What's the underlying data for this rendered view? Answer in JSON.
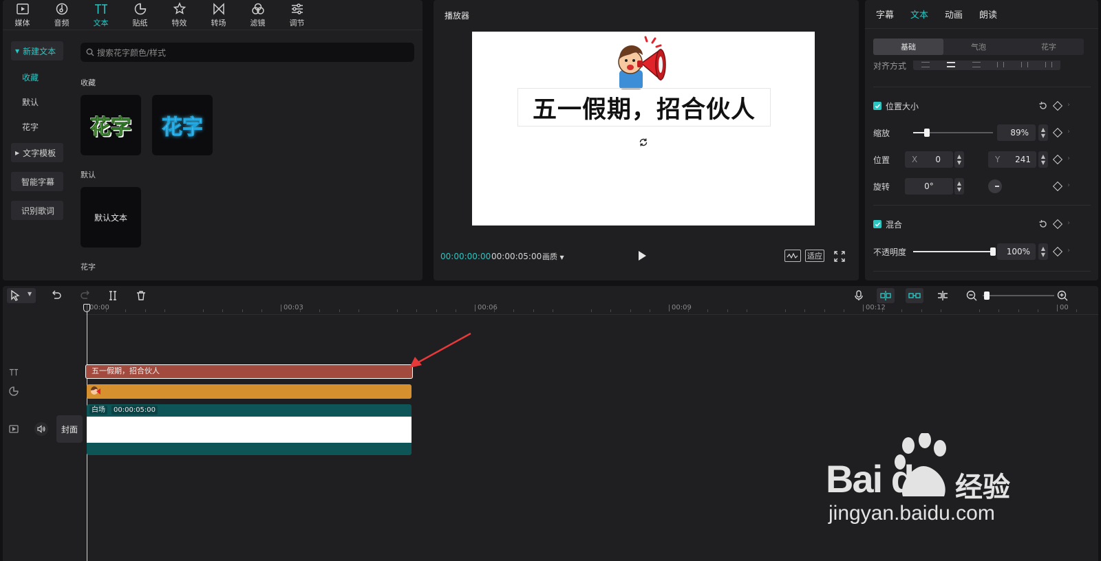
{
  "library": {
    "toolbar": [
      {
        "label": "媒体",
        "icon": "media-icon"
      },
      {
        "label": "音频",
        "icon": "audio-icon"
      },
      {
        "label": "文本",
        "icon": "text-icon"
      },
      {
        "label": "贴纸",
        "icon": "sticker-icon"
      },
      {
        "label": "特效",
        "icon": "effects-icon"
      },
      {
        "label": "转场",
        "icon": "transition-icon"
      },
      {
        "label": "滤镜",
        "icon": "filter-icon"
      },
      {
        "label": "调节",
        "icon": "adjust-icon"
      }
    ],
    "active_tool": "文本",
    "sidebar": {
      "new_text": "新建文本",
      "favorites": "收藏",
      "default": "默认",
      "fancy": "花字",
      "text_template": "文字模板",
      "smart_caption": "智能字幕",
      "lyrics": "识别歌词"
    },
    "search_placeholder": "搜索花字颜色/样式",
    "sections": {
      "favorites": "收藏",
      "default": "默认",
      "fancy": "花字"
    },
    "tiles": {
      "fancy1": "花字",
      "fancy2": "花字",
      "default_text": "默认文本"
    }
  },
  "player": {
    "title": "播放器",
    "canvas_text": "五一假期，招合伙人",
    "current_time": "00:00:00:00",
    "total_time": "00:00:05:00",
    "quality": "画质",
    "fit_button": "适应"
  },
  "properties": {
    "tabs": [
      "字幕",
      "文本",
      "动画",
      "朗读"
    ],
    "active_tab": "文本",
    "subtabs": [
      "基础",
      "气泡",
      "花字"
    ],
    "active_subtab": "基础",
    "align_label": "对齐方式",
    "position_size": {
      "title": "位置大小",
      "scale_label": "缩放",
      "scale_value": "89%",
      "scale_fraction": 0.2,
      "position_label": "位置",
      "x_label": "X",
      "x_value": "0",
      "y_label": "Y",
      "y_value": "241",
      "rotation_label": "旋转",
      "rotation_value": "0°"
    },
    "blend": {
      "title": "混合",
      "opacity_label": "不透明度",
      "opacity_value": "100%",
      "opacity_fraction": 1.0
    }
  },
  "timeline": {
    "ruler_labels": [
      "00:00",
      "00:03",
      "00:06",
      "00:09",
      "00:12",
      "00"
    ],
    "text_clip": "五一假期，招合伙人",
    "video_clip_name": "白场",
    "video_clip_duration": "00:00:05:00",
    "cover_label": "封面"
  },
  "watermark": {
    "brand": "Bai du",
    "brand_cn": "经验",
    "url": "jingyan.baidu.com"
  },
  "colors": {
    "accent": "#29c6c2",
    "text_clip": "#a34a3e",
    "sticker_clip": "#d6912e",
    "video_clip": "#0e5558"
  }
}
